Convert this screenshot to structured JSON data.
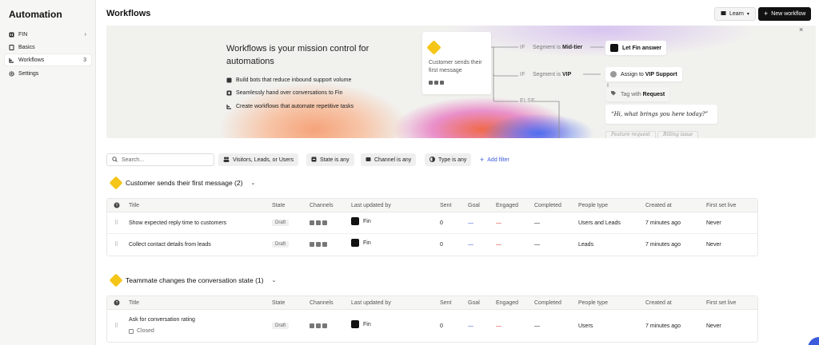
{
  "sidebar": {
    "title": "Automation",
    "items": [
      {
        "label": "FIN",
        "icon": "fin-icon",
        "right": "›"
      },
      {
        "label": "Basics",
        "icon": "book-icon",
        "right": ""
      },
      {
        "label": "Workflows",
        "icon": "workflow-icon",
        "right": "3"
      },
      {
        "label": "Settings",
        "icon": "gear-icon",
        "right": ""
      }
    ]
  },
  "header": {
    "title": "Workflows",
    "learn_label": "Learn",
    "new_label": "New workflow"
  },
  "hero": {
    "heading": "Workflows is your mission control for automations",
    "bullets": [
      "Build bots that reduce inbound support volume",
      "Seamlessly hand over conversations to Fin",
      "Create workflows that automate repetitive tasks"
    ],
    "start_card": "Customer sends their first message",
    "flow": {
      "if1": "IF",
      "seg1_prefix": "Segment is",
      "seg1_value": "Mid-tier",
      "action1": "Let Fin answer",
      "if2": "IF",
      "seg2_prefix": "Segment is",
      "seg2_value": "VIP",
      "action2_prefix": "Assign to",
      "action2_value": "VIP Support",
      "action3_prefix": "Tag with",
      "action3_value": "Request",
      "else": "ELSE",
      "quote": "“Hi, what brings you here today?”",
      "pill1": "Feature request",
      "pill2": "Billing issue"
    }
  },
  "filters": {
    "search_placeholder": "Search...",
    "audience": "Visitors, Leads, or Users",
    "state": "State is any",
    "channel": "Channel is any",
    "type": "Type is any",
    "add": "Add filter"
  },
  "columns": [
    "Title",
    "State",
    "Channels",
    "Last updated by",
    "Sent",
    "Goal",
    "Engaged",
    "Completed",
    "People type",
    "Created at",
    "First set live"
  ],
  "groups": [
    {
      "title": "Customer sends their first message (2)",
      "rows": [
        {
          "title": "Show expected reply time to customers",
          "state": "Draft",
          "updated_by": "Fin",
          "sent": "0",
          "goal": "—",
          "engaged": "—",
          "completed": "—",
          "people": "Users and Leads",
          "created": "7 minutes ago",
          "live": "Never"
        },
        {
          "title": "Collect contact details from leads",
          "state": "Draft",
          "updated_by": "Fin",
          "sent": "0",
          "goal": "—",
          "engaged": "—",
          "completed": "—",
          "people": "Leads",
          "created": "7 minutes ago",
          "live": "Never"
        }
      ]
    },
    {
      "title": "Teammate changes the conversation state (1)",
      "rows": [
        {
          "title": "Ask for conversation rating",
          "subtitle": "Closed",
          "state": "Draft",
          "updated_by": "Fin",
          "sent": "0",
          "goal": "—",
          "engaged": "—",
          "completed": "—",
          "people": "Users",
          "created": "7 minutes ago",
          "live": "Never"
        }
      ]
    }
  ],
  "colors": {
    "accent": "#3b5bdb",
    "trigger": "#f5c518",
    "primary_button": "#111111"
  }
}
